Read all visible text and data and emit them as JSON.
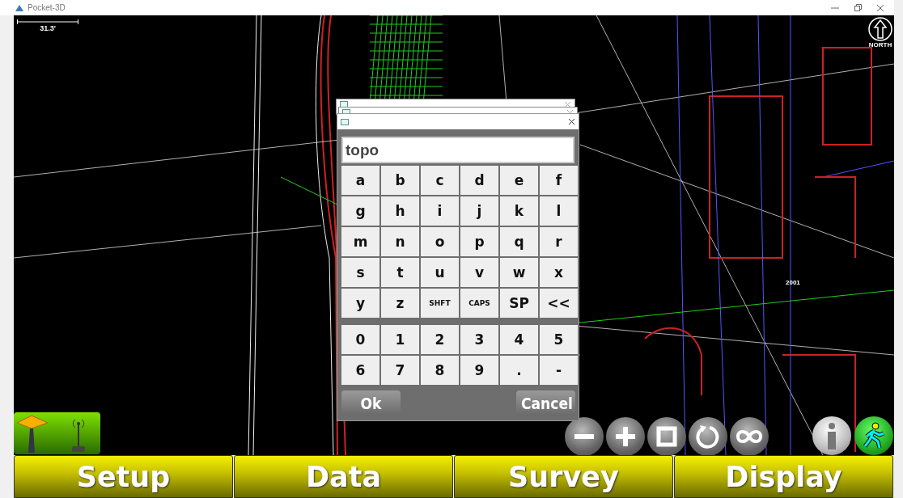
{
  "window": {
    "title": "Pocket-3D"
  },
  "map": {
    "scale_label": "31.3'",
    "north_label": "NORTH",
    "point_label": "2001"
  },
  "keyboard_dialog": {
    "input": {
      "value": "topo"
    },
    "letter_rows": [
      [
        "a",
        "b",
        "c",
        "d",
        "e",
        "f"
      ],
      [
        "g",
        "h",
        "i",
        "j",
        "k",
        "l"
      ],
      [
        "m",
        "n",
        "o",
        "p",
        "q",
        "r"
      ],
      [
        "s",
        "t",
        "u",
        "v",
        "w",
        "x"
      ],
      [
        "y",
        "z",
        "SHFT",
        "CAPS",
        "SP",
        "<<"
      ]
    ],
    "number_rows": [
      [
        "0",
        "1",
        "2",
        "3",
        "4",
        "5"
      ],
      [
        "6",
        "7",
        "8",
        "9",
        ".",
        "-"
      ]
    ],
    "ok_button": "Ok",
    "cancel_button": "Cancel"
  },
  "menu": [
    "Setup",
    "Data",
    "Survey",
    "Display"
  ]
}
